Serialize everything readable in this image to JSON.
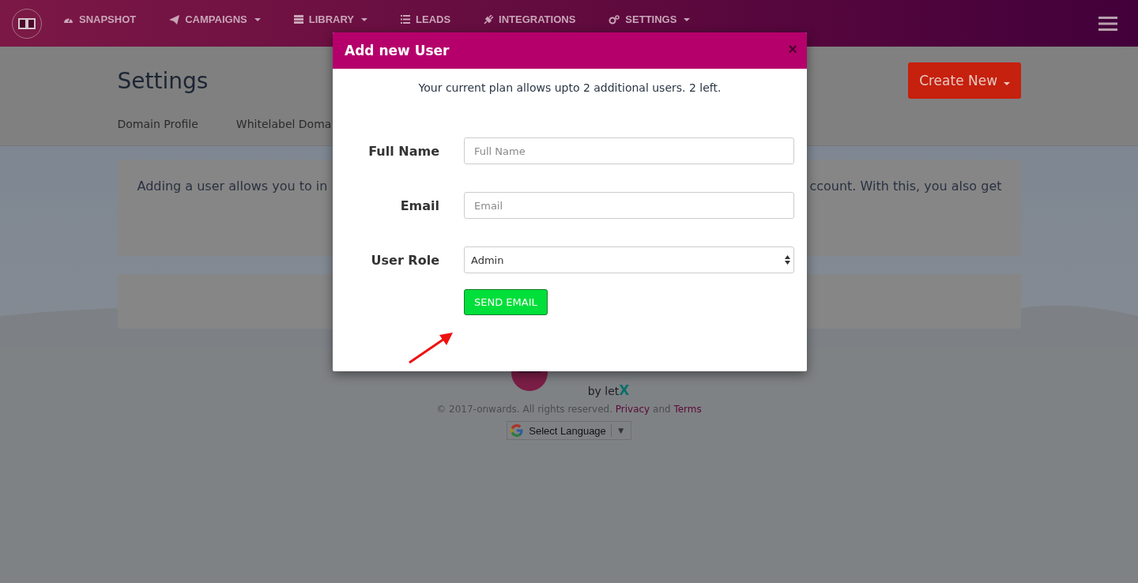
{
  "nav": {
    "items": [
      {
        "label": "SNAPSHOT",
        "dropdown": false
      },
      {
        "label": "CAMPAIGNS",
        "dropdown": true
      },
      {
        "label": "LIBRARY",
        "dropdown": true
      },
      {
        "label": "LEADS",
        "dropdown": false
      },
      {
        "label": "INTEGRATIONS",
        "dropdown": false
      },
      {
        "label": "SETTINGS",
        "dropdown": true
      }
    ]
  },
  "page": {
    "title": "Settings",
    "create_button": "Create New",
    "tabs": [
      {
        "label": "Domain Profile"
      },
      {
        "label": "Whitelabel Doma"
      }
    ]
  },
  "info_card": {
    "text_left": "Adding a user allows you to in",
    "text_right": "ccount. With this, you also get"
  },
  "footer": {
    "byline": "by let",
    "byline_mark": "X",
    "copyright": "© 2017-onwards. All rights reserved.",
    "privacy": "Privacy",
    "joiner": "and",
    "terms": "Terms",
    "language": "Select Language",
    "language_caret": "▼"
  },
  "modal": {
    "title": "Add new User",
    "close": "×",
    "note": "Your current plan allows upto 2 additional users. 2 left.",
    "fields": [
      {
        "kind": "text",
        "label": "Full Name",
        "placeholder": "Full Name"
      },
      {
        "kind": "text",
        "label": "Email",
        "placeholder": "Email"
      },
      {
        "kind": "select",
        "label": "User Role",
        "value": "Admin"
      }
    ],
    "submit": "SEND EMAIL"
  }
}
